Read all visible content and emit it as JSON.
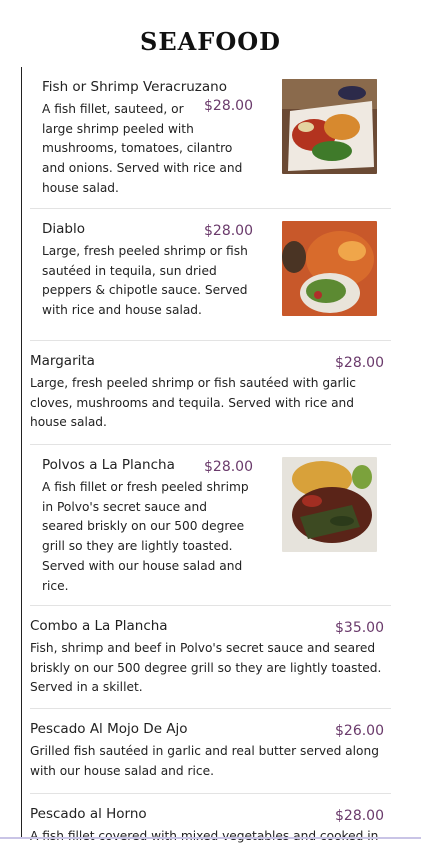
{
  "section": {
    "title": "SEAFOOD"
  },
  "items": [
    {
      "name": "Fish or Shrimp Veracruzano",
      "price": "$28.00",
      "desc_lines": [
        "A fish fillet, sauteed, or",
        "large shrimp peeled with",
        "mushrooms, tomatoes, cilantro",
        "and onions. Served with rice and",
        "house salad."
      ],
      "image": "veracruzano-dish-photo"
    },
    {
      "name": "Diablo",
      "price": "$28.00",
      "desc_lines": [
        "Large, fresh peeled shrimp or fish",
        "sautéed in tequila, sun dried",
        "peppers & chipotle sauce. Served",
        "with rice and house salad."
      ],
      "image": "diablo-dish-photo"
    },
    {
      "name": "Margarita",
      "price": "$28.00",
      "desc_lines": [
        "Large, fresh peeled shrimp or fish sautéed with garlic",
        "cloves, mushrooms and tequila. Served with rice and",
        "house salad."
      ]
    },
    {
      "name": "Polvos a La Plancha",
      "price": "$28.00",
      "desc_lines": [
        "A fish fillet or fresh peeled shrimp",
        "in Polvo's secret sauce and",
        "seared briskly on our 500 degree",
        "grill so they are lightly toasted.",
        "Served with our house salad and",
        "rice."
      ],
      "image": "plancha-dish-photo"
    },
    {
      "name": "Combo a La Plancha",
      "price": "$35.00",
      "desc_lines": [
        "Fish, shrimp and beef in Polvo's secret sauce and seared",
        "briskly on our 500 degree grill so they are lightly toasted.",
        "Served in a skillet."
      ]
    },
    {
      "name": "Pescado Al Mojo De Ajo",
      "price": "$26.00",
      "desc_lines": [
        "Grilled fish sautéed in garlic and real butter served along",
        "with our house salad and rice."
      ]
    },
    {
      "name": "Pescado al Horno",
      "price": "$28.00",
      "desc_lines": [
        "A fish fillet covered with mixed vegetables and cooked in"
      ]
    }
  ]
}
